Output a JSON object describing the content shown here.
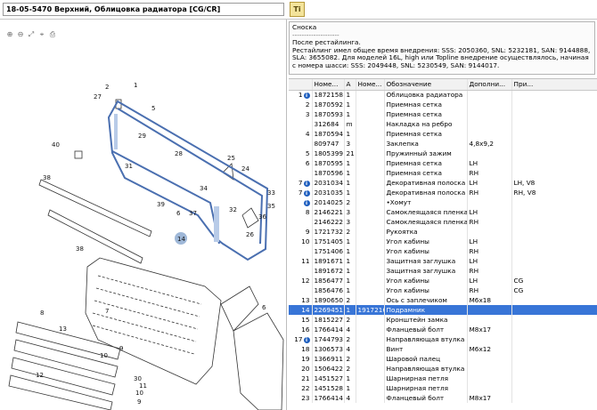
{
  "header": {
    "title": "18-05-5470 Верхний, Облицовка радиатора [CG/CR]",
    "ti_button": "Ti"
  },
  "toolbar": {
    "tools": [
      "zoom-in-icon",
      "zoom-out-icon",
      "fit-icon",
      "select-icon",
      "print-icon"
    ]
  },
  "drawing": {
    "callouts": [
      "27",
      "2",
      "1",
      "5",
      "40",
      "29",
      "28",
      "31",
      "25",
      "24",
      "34",
      "33",
      "35",
      "32",
      "36",
      "39",
      "6",
      "37",
      "38",
      "26",
      "14",
      "38",
      "8",
      "7",
      "30",
      "6",
      "13",
      "10",
      "9",
      "12",
      "10",
      "9",
      "11"
    ]
  },
  "note": {
    "title": "Сноска",
    "separator": "--------------------",
    "lines": [
      "После рестайлинга.",
      " Рестайлинг имел общее время внедрения: SSS: 2050360, SNL: 5232181, SAN: 9144888, SLA: 3655082. Для моделей 16L, high или  Topline внедрение осуществлялось, начиная с номера шасси: SSS: 2049448, SNL: 5230549, SAN: 9144017."
    ]
  },
  "table": {
    "columns": [
      "",
      "Номе...",
      "А",
      "Номе...",
      "Обозначение",
      "Дополни...",
      "При..."
    ],
    "rows": [
      {
        "pos": "1",
        "info": true,
        "part": "1872158",
        "qty": "1",
        "ref": "",
        "name": "Облицовка радиатора",
        "extra": "",
        "note": ""
      },
      {
        "pos": "2",
        "info": false,
        "part": "1870592",
        "qty": "1",
        "ref": "",
        "name": "Приемная сетка",
        "extra": "",
        "note": ""
      },
      {
        "pos": "3",
        "info": false,
        "part": "1870593",
        "qty": "1",
        "ref": "",
        "name": "Приемная сетка",
        "extra": "",
        "note": ""
      },
      {
        "pos": "",
        "info": false,
        "part": "312684",
        "qty": "m",
        "ref": "",
        "name": "Накладка на ребро",
        "extra": "",
        "note": ""
      },
      {
        "pos": "4",
        "info": false,
        "part": "1870594",
        "qty": "1",
        "ref": "",
        "name": "Приемная сетка",
        "extra": "",
        "note": ""
      },
      {
        "pos": "",
        "info": false,
        "part": "809747",
        "qty": "3",
        "ref": "",
        "name": "Заклепка",
        "extra": "4,8x9,2",
        "note": ""
      },
      {
        "pos": "5",
        "info": false,
        "part": "1805399",
        "qty": "21",
        "ref": "",
        "name": "Пружинный зажим",
        "extra": "",
        "note": ""
      },
      {
        "pos": "6",
        "info": false,
        "part": "1870595",
        "qty": "1",
        "ref": "",
        "name": "Приемная сетка",
        "extra": "LH",
        "note": ""
      },
      {
        "pos": "",
        "info": false,
        "part": "1870596",
        "qty": "1",
        "ref": "",
        "name": "Приемная сетка",
        "extra": "RH",
        "note": ""
      },
      {
        "pos": "7",
        "info": true,
        "part": "2031034",
        "qty": "1",
        "ref": "",
        "name": "Декоративная полоска",
        "extra": "LH",
        "note": "LH, V8"
      },
      {
        "pos": "7",
        "info": true,
        "part": "2031035",
        "qty": "1",
        "ref": "",
        "name": "Декоративная полоска",
        "extra": "RH",
        "note": "RH, V8"
      },
      {
        "pos": "",
        "info": true,
        "part": "2014025",
        "qty": "2",
        "ref": "",
        "name": "•Хомут",
        "extra": "",
        "note": ""
      },
      {
        "pos": "8",
        "info": false,
        "part": "2146221",
        "qty": "3",
        "ref": "",
        "name": "Самоклеящаяся пленка",
        "extra": "LH",
        "note": ""
      },
      {
        "pos": "",
        "info": false,
        "part": "2146222",
        "qty": "3",
        "ref": "",
        "name": "Самоклеящаяся пленка",
        "extra": "RH",
        "note": ""
      },
      {
        "pos": "9",
        "info": false,
        "part": "1721732",
        "qty": "2",
        "ref": "",
        "name": "Рукоятка",
        "extra": "",
        "note": ""
      },
      {
        "pos": "10",
        "info": false,
        "part": "1751405",
        "qty": "1",
        "ref": "",
        "name": "Угол кабины",
        "extra": "LH",
        "note": ""
      },
      {
        "pos": "",
        "info": false,
        "part": "1751406",
        "qty": "1",
        "ref": "",
        "name": "Угол кабины",
        "extra": "RH",
        "note": ""
      },
      {
        "pos": "11",
        "info": false,
        "part": "1891671",
        "qty": "1",
        "ref": "",
        "name": "Защитная заглушка",
        "extra": "LH",
        "note": ""
      },
      {
        "pos": "",
        "info": false,
        "part": "1891672",
        "qty": "1",
        "ref": "",
        "name": "Защитная заглушка",
        "extra": "RH",
        "note": ""
      },
      {
        "pos": "12",
        "info": false,
        "part": "1856477",
        "qty": "1",
        "ref": "",
        "name": "Угол кабины",
        "extra": "LH",
        "note": "CG"
      },
      {
        "pos": "",
        "info": false,
        "part": "1856476",
        "qty": "1",
        "ref": "",
        "name": "Угол кабины",
        "extra": "RH",
        "note": "CG"
      },
      {
        "pos": "13",
        "info": false,
        "part": "1890650",
        "qty": "2",
        "ref": "",
        "name": "Ось с заплечиком",
        "extra": "M6x18",
        "note": ""
      },
      {
        "pos": "14",
        "info": false,
        "part": "2269451",
        "qty": "1",
        "ref": "1917216",
        "name": "Подрамник",
        "extra": "",
        "note": "",
        "selected": true
      },
      {
        "pos": "15",
        "info": false,
        "part": "1815227",
        "qty": "2",
        "ref": "",
        "name": "Кронштейн замка",
        "extra": "",
        "note": ""
      },
      {
        "pos": "16",
        "info": false,
        "part": "1766414",
        "qty": "4",
        "ref": "",
        "name": "Фланцевый болт",
        "extra": "M8x17",
        "note": ""
      },
      {
        "pos": "17",
        "info": true,
        "part": "1744793",
        "qty": "2",
        "ref": "",
        "name": "Направляющая втулка",
        "extra": "",
        "note": ""
      },
      {
        "pos": "18",
        "info": false,
        "part": "1306573",
        "qty": "4",
        "ref": "",
        "name": "Винт",
        "extra": "M6x12",
        "note": ""
      },
      {
        "pos": "19",
        "info": false,
        "part": "1366911",
        "qty": "2",
        "ref": "",
        "name": "Шаровой палец",
        "extra": "",
        "note": ""
      },
      {
        "pos": "20",
        "info": false,
        "part": "1506422",
        "qty": "2",
        "ref": "",
        "name": "Направляющая втулка",
        "extra": "",
        "note": ""
      },
      {
        "pos": "21",
        "info": false,
        "part": "1451527",
        "qty": "1",
        "ref": "",
        "name": "Шарнирная петля",
        "extra": "",
        "note": ""
      },
      {
        "pos": "22",
        "info": false,
        "part": "1451528",
        "qty": "1",
        "ref": "",
        "name": "Шарнирная петля",
        "extra": "",
        "note": ""
      },
      {
        "pos": "23",
        "info": false,
        "part": "1766414",
        "qty": "4",
        "ref": "",
        "name": "Фланцевый болт",
        "extra": "M8x17",
        "note": ""
      }
    ]
  }
}
